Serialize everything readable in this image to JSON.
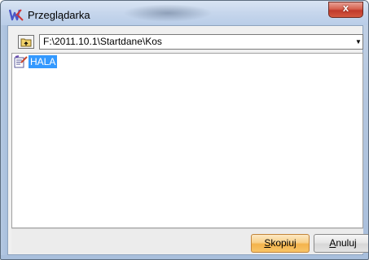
{
  "window": {
    "title": "Przeglądarka",
    "close_symbol": "x",
    "accent_color": "#3399ff"
  },
  "toolbar": {
    "up_button_icon": "folder-up-icon",
    "path_value": "F:\\2011.10.1\\Startdane\\Kos",
    "dropdown_icon": "chevron-down-icon"
  },
  "list": {
    "items": [
      {
        "label": "HALA",
        "icon": "document-edit-icon",
        "selected": true
      }
    ]
  },
  "buttons": {
    "copy_hotkey": "S",
    "copy_rest": "kopiuj",
    "cancel_hotkey": "A",
    "cancel_rest": "nuluj"
  }
}
